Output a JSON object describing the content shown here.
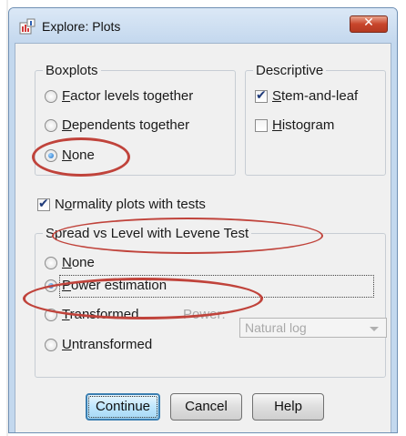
{
  "window": {
    "title": "Explore: Plots",
    "close_label": "✕"
  },
  "boxplots": {
    "legend": "Boxplots",
    "options": [
      {
        "accel": "F",
        "rest": "actor levels together",
        "selected": false
      },
      {
        "accel": "D",
        "rest": "ependents together",
        "selected": false
      },
      {
        "accel": "N",
        "rest": "one",
        "selected": true
      }
    ]
  },
  "descriptive": {
    "legend": "Descriptive",
    "options": [
      {
        "accel": "S",
        "rest": "tem-and-leaf",
        "checked": true
      },
      {
        "accel": "H",
        "rest": "istogram",
        "checked": false
      }
    ]
  },
  "normality": {
    "accel": "o",
    "before": "N",
    "after": "rmality plots with tests",
    "checked": true
  },
  "spread": {
    "legend": "Spread vs Level with Levene Test",
    "options": [
      {
        "accel": "N",
        "rest": "one",
        "selected": false
      },
      {
        "accel": "P",
        "rest": "ower estimation",
        "selected": true
      },
      {
        "accel": "T",
        "rest": "ransformed",
        "selected": false
      },
      {
        "accel": "U",
        "rest": "ntransformed",
        "selected": false
      }
    ],
    "power_label": "Power:",
    "power_value": "Natural log"
  },
  "buttons": {
    "continue": "Continue",
    "cancel": "Cancel",
    "help": "Help"
  },
  "colors": {
    "annotation_red": "#c0433b",
    "close_button": "#c8452b",
    "dialog_bg": "#f0f0f0"
  }
}
